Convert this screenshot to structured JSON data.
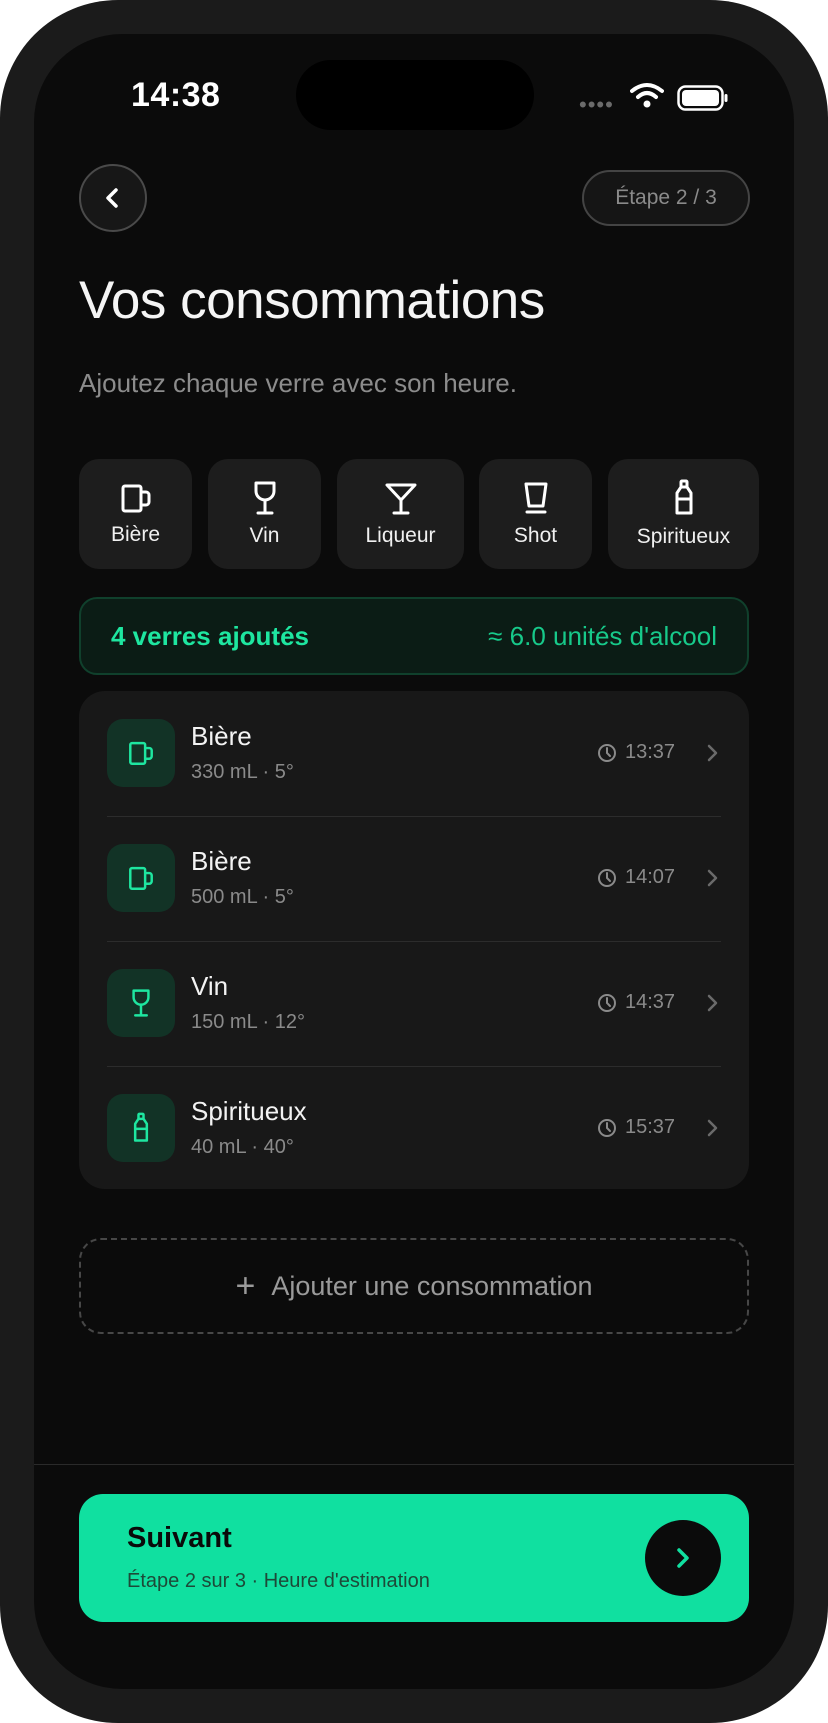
{
  "status_bar": {
    "time": "14:38",
    "signal": "••••"
  },
  "header": {
    "step_label": "Étape 2 / 3"
  },
  "page": {
    "title": "Vos consommations",
    "subtitle": "Ajoutez chaque verre avec son heure."
  },
  "drink_types": [
    {
      "label": "Bière",
      "icon": "beer-mug-icon"
    },
    {
      "label": "Vin",
      "icon": "wine-glass-icon"
    },
    {
      "label": "Liqueur",
      "icon": "cocktail-glass-icon"
    },
    {
      "label": "Shot",
      "icon": "shot-glass-icon"
    },
    {
      "label": "Spiritueux",
      "icon": "bottle-icon"
    }
  ],
  "summary": {
    "count_text": "4 verres ajoutés",
    "units_text": "≈ 6.0 unités d'alcool"
  },
  "drinks": [
    {
      "name": "Bière",
      "detail": "330 mL · 5°",
      "time": "13:37",
      "icon": "beer-mug-icon"
    },
    {
      "name": "Bière",
      "detail": "500 mL · 5°",
      "time": "14:07",
      "icon": "beer-mug-icon"
    },
    {
      "name": "Vin",
      "detail": "150 mL · 12°",
      "time": "14:37",
      "icon": "wine-glass-icon"
    },
    {
      "name": "Spiritueux",
      "detail": "40 mL · 40°",
      "time": "15:37",
      "icon": "bottle-icon"
    }
  ],
  "add_button": {
    "label": "Ajouter une consommation"
  },
  "next_button": {
    "title": "Suivant",
    "subtitle": "Étape 2 sur 3 · Heure d'estimation"
  },
  "colors": {
    "accent": "#10e0a0",
    "background": "#0b0b0b",
    "card": "#181818",
    "text_muted": "#8a8a8a"
  }
}
